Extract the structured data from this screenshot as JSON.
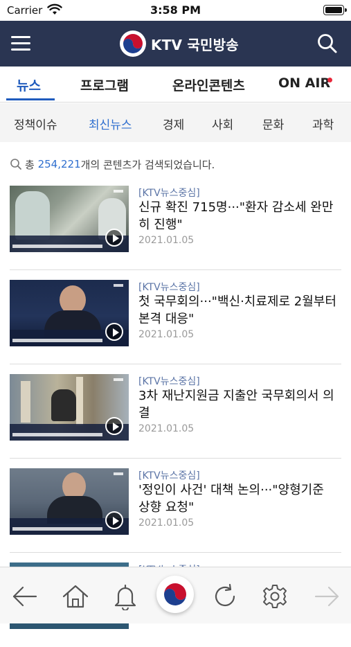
{
  "status_bar": {
    "carrier": "Carrier",
    "time": "3:58 PM"
  },
  "header": {
    "logo_text": "KTV 국민방송",
    "menu_icon": "hamburger-menu-icon",
    "search_icon": "search-icon"
  },
  "main_tabs": [
    {
      "label": "뉴스",
      "active": true
    },
    {
      "label": "프로그램",
      "active": false
    },
    {
      "label": "온라인콘텐츠",
      "active": false
    },
    {
      "label": "ON AIR",
      "active": false
    }
  ],
  "sub_tabs": [
    {
      "label": "정책이슈",
      "active": false
    },
    {
      "label": "최신뉴스",
      "active": true
    },
    {
      "label": "경제",
      "active": false
    },
    {
      "label": "사회",
      "active": false
    },
    {
      "label": "문화",
      "active": false
    },
    {
      "label": "과학",
      "active": false
    }
  ],
  "results": {
    "prefix": "총",
    "count": "254,221",
    "suffix": "개의 콘텐츠가 검색되었습니다."
  },
  "articles": [
    {
      "tag": "[KTV뉴스중심]",
      "title": "신규 확진 715명···\"환자 감소세 완만히 진행\"",
      "date": "2021.01.05"
    },
    {
      "tag": "[KTV뉴스중심]",
      "title": "첫 국무회의···\"백신·치료제로 2월부터 본격 대응\"",
      "date": "2021.01.05"
    },
    {
      "tag": "[KTV뉴스중심]",
      "title": "3차 재난지원금 지출안 국무회의서 의결",
      "date": "2021.01.05"
    },
    {
      "tag": "[KTV뉴스중심]",
      "title": "'정인이 사건' 대책 논의···\"양형기준 상향 요청\"",
      "date": "2021.01.05"
    },
    {
      "tag": "[KTV뉴스중심]",
      "title": "",
      "date": ""
    }
  ],
  "bottom_bar": [
    "back-arrow-icon",
    "home-icon",
    "bell-icon",
    "ktv-logo-icon",
    "refresh-icon",
    "settings-gear-icon",
    "forward-arrow-icon"
  ],
  "colors": {
    "header_bg": "#2a3552",
    "accent_blue": "#1f5bbd",
    "onair_red": "#e8273a"
  }
}
